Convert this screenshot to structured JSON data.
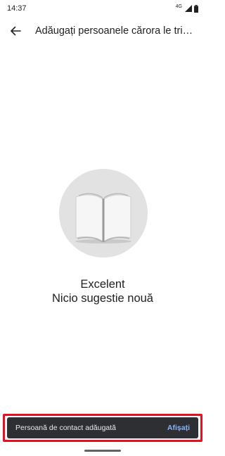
{
  "status_bar": {
    "time": "14:37",
    "network_label": "4G",
    "icons": [
      "signal-icon",
      "battery-icon"
    ]
  },
  "app_bar": {
    "back_icon": "arrow-back-icon",
    "title": "Adăugați persoanele cărora le trimiteți"
  },
  "empty_state": {
    "illustration_icon": "open-book-icon",
    "title": "Excelent",
    "subtitle": "Nicio sugestie nouă"
  },
  "snackbar": {
    "message": "Persoană de contact adăugată",
    "action_label": "Afișați",
    "action_color": "#8ab4f8",
    "highlight_color": "#e8101e"
  }
}
